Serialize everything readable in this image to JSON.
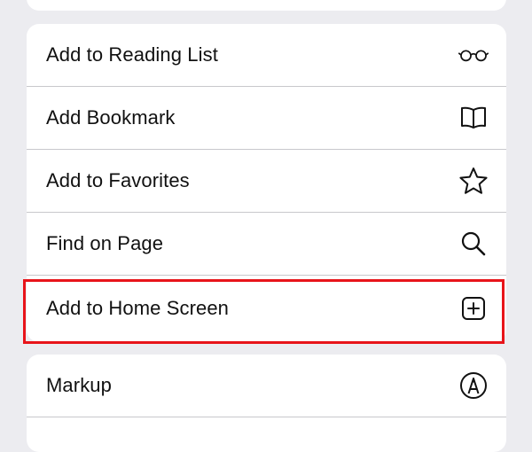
{
  "menu": {
    "items": [
      {
        "label": "Add to Reading List",
        "icon": "glasses-icon"
      },
      {
        "label": "Add Bookmark",
        "icon": "book-icon"
      },
      {
        "label": "Add to Favorites",
        "icon": "star-icon"
      },
      {
        "label": "Find on Page",
        "icon": "search-icon"
      },
      {
        "label": "Add to Home Screen",
        "icon": "plus-square-icon"
      }
    ],
    "secondary_items": [
      {
        "label": "Markup",
        "icon": "markup-pen-icon"
      }
    ]
  },
  "highlight": {
    "color": "#e8141a",
    "target": "Add to Home Screen"
  },
  "colors": {
    "background": "#ececf0",
    "card": "#ffffff",
    "separator": "#c8c8cc",
    "text": "#111111"
  }
}
